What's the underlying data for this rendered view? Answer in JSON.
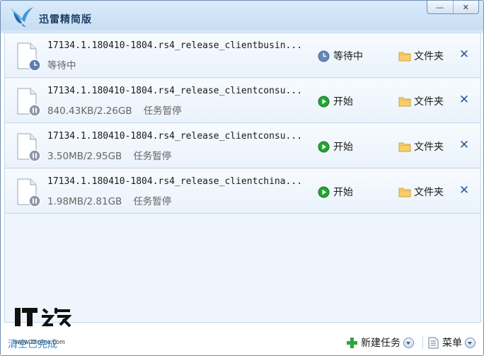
{
  "app": {
    "title": "迅雷精简版"
  },
  "window_controls": {
    "minimize": "—",
    "close": "✕"
  },
  "tasks": [
    {
      "name": "17134.1.180410-1804.rs4_release_clientbusin...",
      "progress": "",
      "status": "等待中",
      "action": "等待中",
      "action_icon": "clock-icon",
      "folder": "文件夹"
    },
    {
      "name": "17134.1.180410-1804.rs4_release_clientconsu...",
      "progress": "840.43KB/2.26GB",
      "status": "任务暂停",
      "action": "开始",
      "action_icon": "play-icon",
      "folder": "文件夹"
    },
    {
      "name": "17134.1.180410-1804.rs4_release_clientconsu...",
      "progress": "3.50MB/2.95GB",
      "status": "任务暂停",
      "action": "开始",
      "action_icon": "play-icon",
      "folder": "文件夹"
    },
    {
      "name": "17134.1.180410-1804.rs4_release_clientchina...",
      "progress": "1.98MB/2.81GB",
      "status": "任务暂停",
      "action": "开始",
      "action_icon": "play-icon",
      "folder": "文件夹"
    }
  ],
  "bottom": {
    "clear_done": "清空已完成",
    "new_task": "新建任务",
    "menu": "菜单"
  },
  "watermark": {
    "logo_text": "IT之家",
    "url": "www.ithome.com"
  },
  "colors": {
    "accent": "#2a5e9a",
    "play_green": "#1f9a2e",
    "link_blue": "#3a8ac8"
  }
}
